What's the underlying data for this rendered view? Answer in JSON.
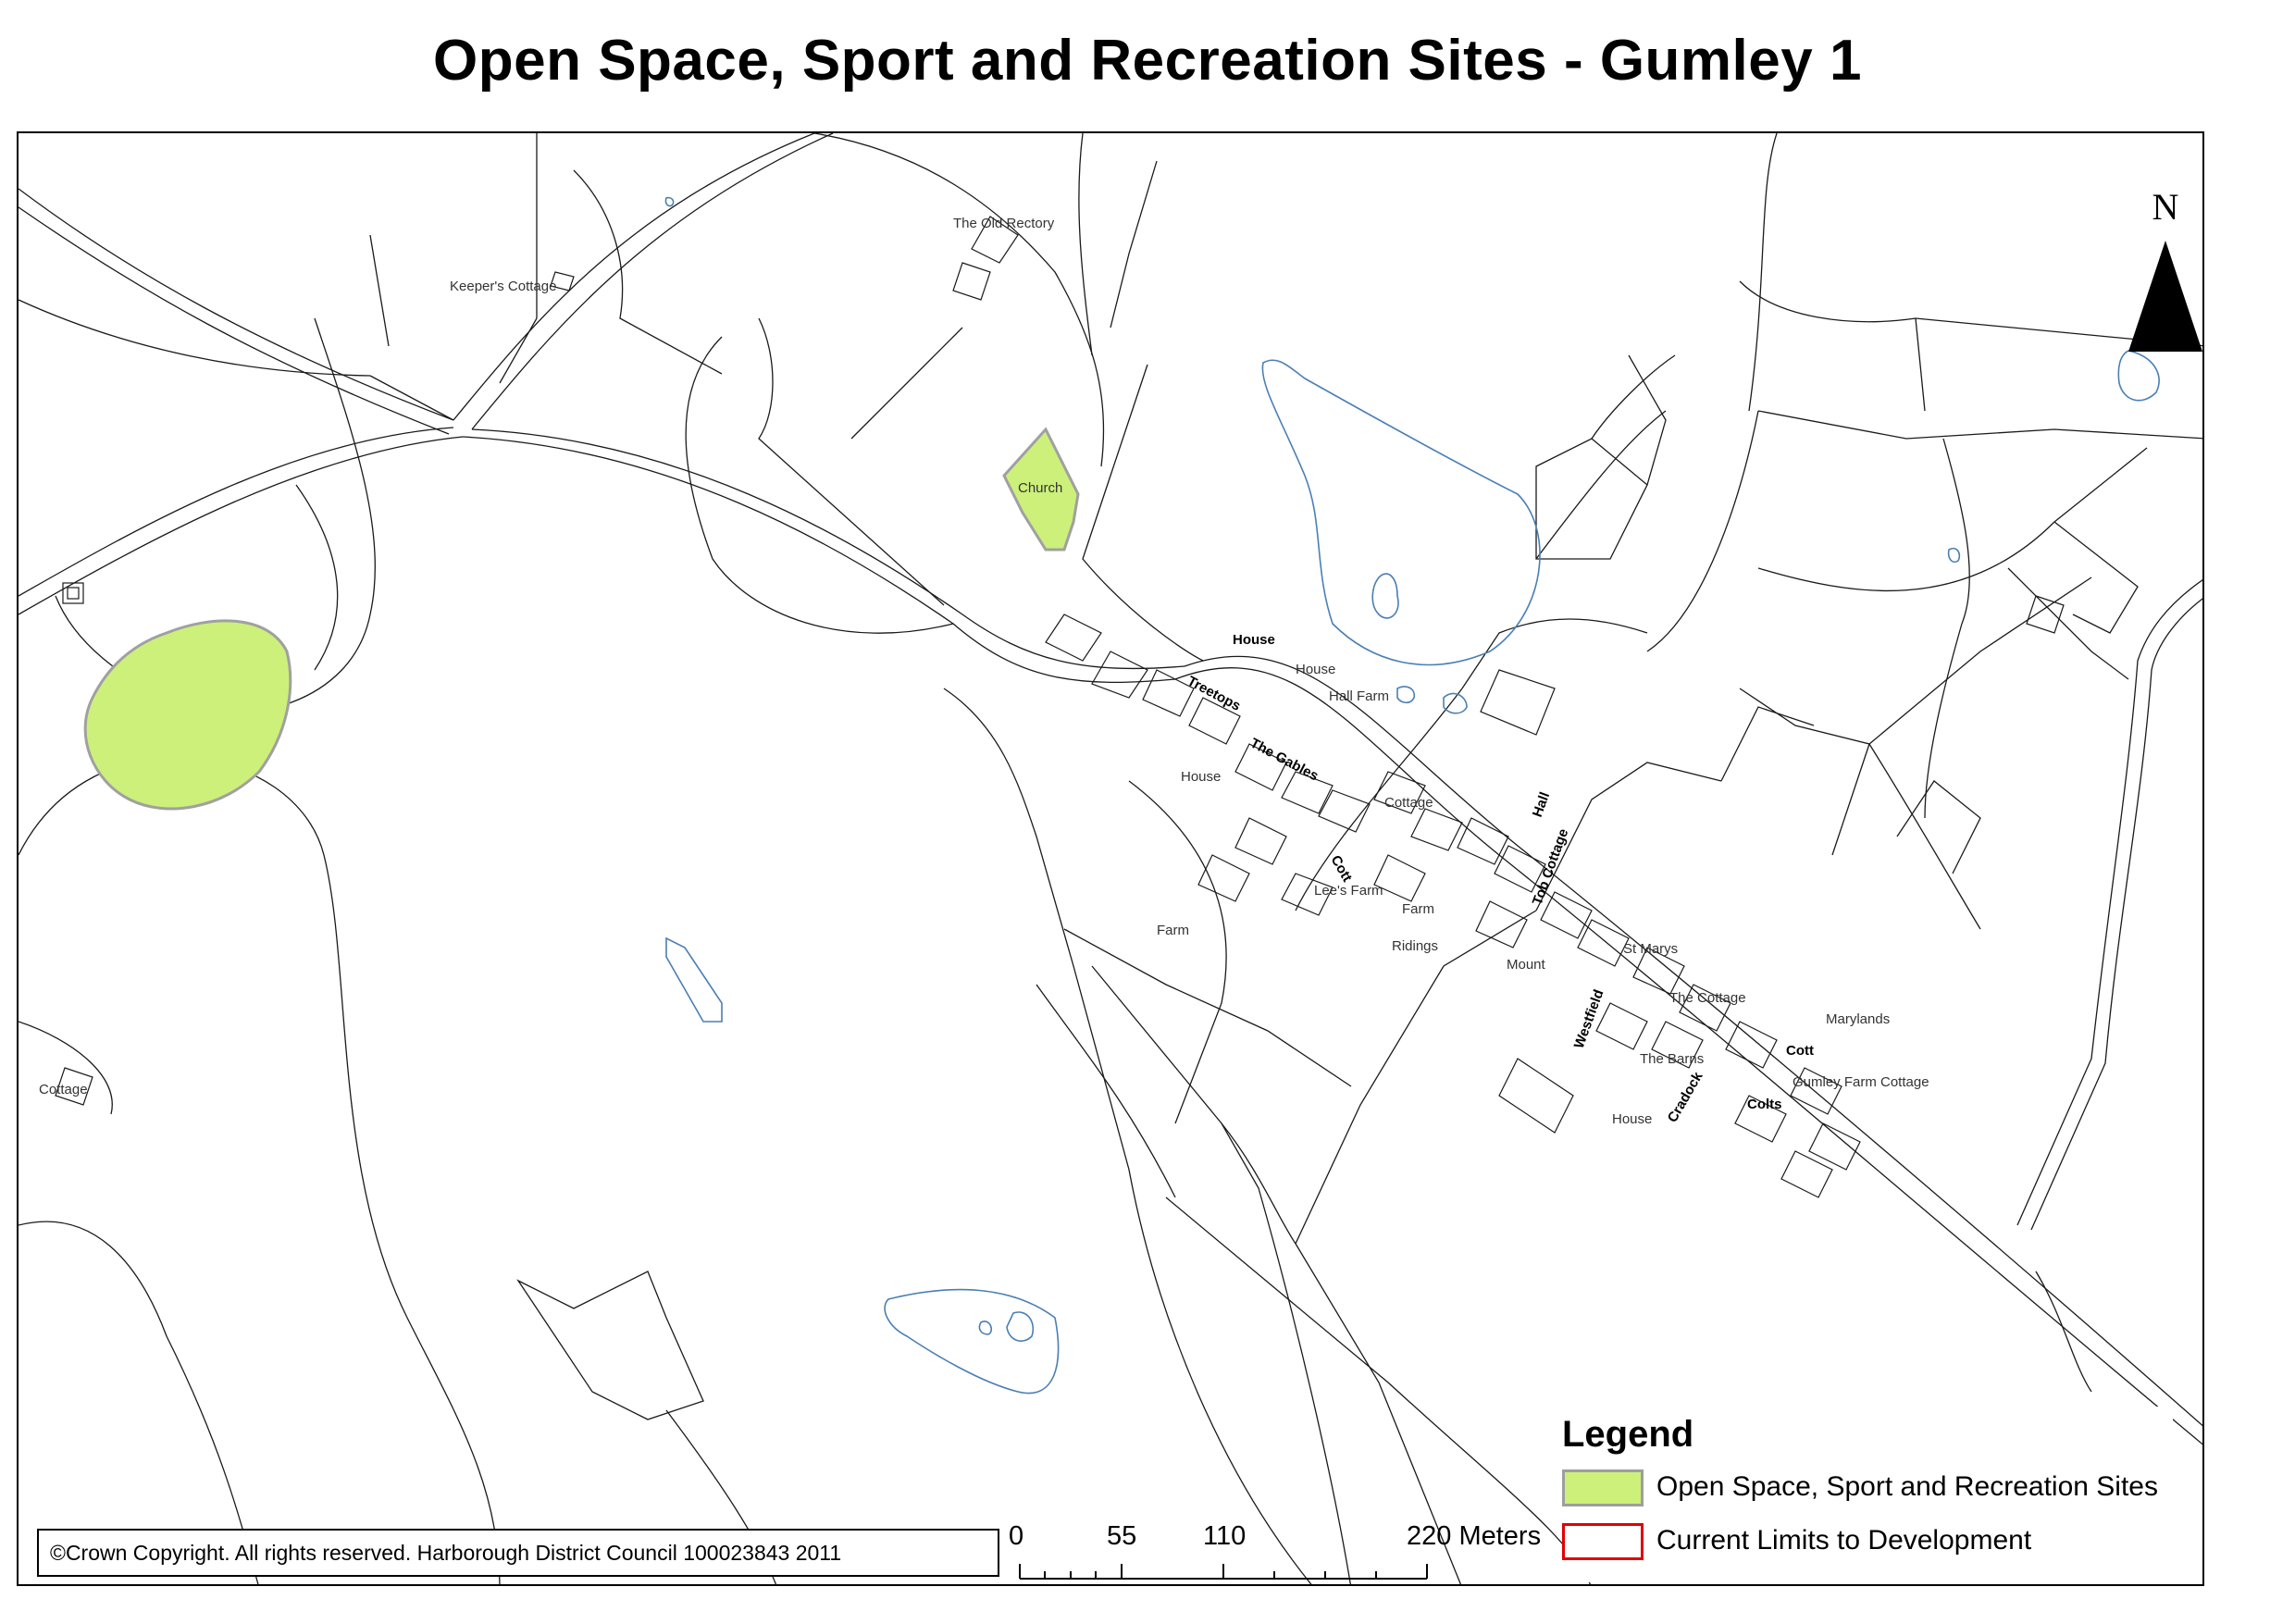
{
  "title": "Open Space, Sport and Recreation Sites - Gumley 1",
  "north_arrow": {
    "letter": "N"
  },
  "map": {
    "place_labels": [
      {
        "text": "The Old Rectory",
        "style": "normal"
      },
      {
        "text": "Keeper's Cottage",
        "style": "normal"
      },
      {
        "text": "Church",
        "style": "normal"
      },
      {
        "text": "House",
        "style": "bold"
      },
      {
        "text": "Treetops",
        "style": "bold"
      },
      {
        "text": "House",
        "style": "normal"
      },
      {
        "text": "Hall Farm",
        "style": "normal"
      },
      {
        "text": "House",
        "style": "normal"
      },
      {
        "text": "The Gables",
        "style": "bold"
      },
      {
        "text": "Cottage",
        "style": "normal"
      },
      {
        "text": "Hall",
        "style": "bold"
      },
      {
        "text": "Tob Cottage",
        "style": "bold"
      },
      {
        "text": "Cott",
        "style": "bold"
      },
      {
        "text": "Lee's Farm",
        "style": "normal"
      },
      {
        "text": "Farm",
        "style": "normal"
      },
      {
        "text": "Farm",
        "style": "normal"
      },
      {
        "text": "Ridings",
        "style": "normal"
      },
      {
        "text": "St Marys",
        "style": "normal"
      },
      {
        "text": "Mount",
        "style": "normal"
      },
      {
        "text": "The Cottage",
        "style": "normal"
      },
      {
        "text": "Marylands",
        "style": "normal"
      },
      {
        "text": "Westfield",
        "style": "bold"
      },
      {
        "text": "Cott",
        "style": "bold"
      },
      {
        "text": "The Barns",
        "style": "normal"
      },
      {
        "text": "Gumley Farm Cottage",
        "style": "normal"
      },
      {
        "text": "Cradock",
        "style": "bold"
      },
      {
        "text": "Colts",
        "style": "bold"
      },
      {
        "text": "House",
        "style": "normal"
      },
      {
        "text": "Cottage",
        "style": "normal"
      }
    ]
  },
  "legend": {
    "title": "Legend",
    "items": [
      {
        "label": "Open Space, Sport and Recreation Sites",
        "fill": "#ccf07a",
        "stroke": "#9e9e9e"
      },
      {
        "label": "Current Limits to Development",
        "fill": "#ffffff",
        "stroke": "#e00000"
      }
    ]
  },
  "scale_bar": {
    "labels": [
      "0",
      "55",
      "110",
      "220 Meters"
    ]
  },
  "copyright": "©Crown Copyright. All rights reserved.  Harborough District Council 100023843  2011",
  "colors": {
    "open_space_fill": "#ccf07a",
    "open_space_stroke": "#a0a0a0",
    "water": "#4a7fb5",
    "parcel_line": "#1a1a1a",
    "development_limit": "#e00000"
  }
}
